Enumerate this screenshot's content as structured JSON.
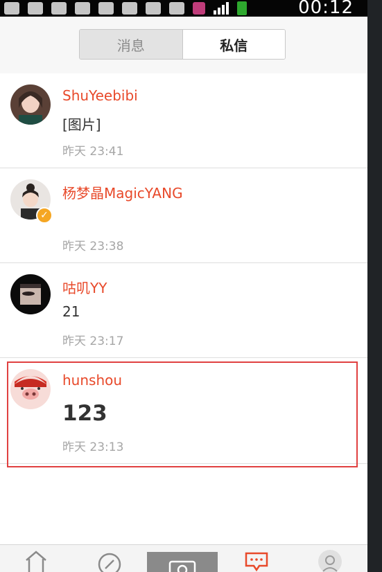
{
  "status_bar": {
    "time": "00:12"
  },
  "tabs": [
    {
      "label": "消息",
      "active": false
    },
    {
      "label": "私信",
      "active": true
    }
  ],
  "messages": [
    {
      "name": "ShuYeebibi",
      "preview": "[图片]",
      "time": "昨天 23:41"
    },
    {
      "name": "杨梦晶MagicYANG",
      "preview": "",
      "time": "昨天 23:38",
      "verified": true
    },
    {
      "name": "咕叽YY",
      "preview": "21",
      "time": "昨天 23:17"
    },
    {
      "name": "hunshou",
      "preview": "123",
      "time": "昨天 23:13",
      "highlighted": true
    }
  ],
  "bottom_nav": {
    "icons": [
      "home-icon",
      "compass-icon",
      "camera-icon",
      "message-icon",
      "profile-icon"
    ]
  },
  "colors": {
    "name_red": "#e8492a",
    "highlight_border": "#e04040",
    "time_gray": "#a6a6a6"
  }
}
